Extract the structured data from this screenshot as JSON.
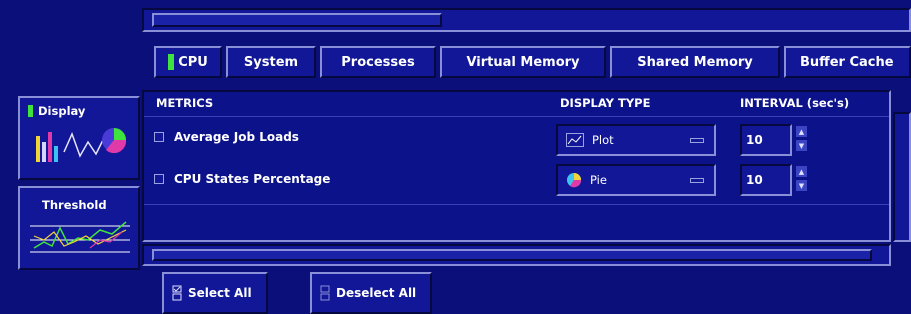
{
  "tabs": [
    {
      "label": "CPU",
      "selected": true
    },
    {
      "label": "System"
    },
    {
      "label": "Processes"
    },
    {
      "label": "Virtual Memory"
    },
    {
      "label": "Shared Memory"
    },
    {
      "label": "Buffer Cache"
    }
  ],
  "sidebar": {
    "display_label": "Display",
    "threshold_label": "Threshold"
  },
  "table": {
    "headers": {
      "metrics": "METRICS",
      "display_type": "DISPLAY TYPE",
      "interval": "INTERVAL (sec's)"
    },
    "rows": [
      {
        "metric": "Average Job Loads",
        "display_type": "Plot",
        "display_icon": "plot-icon",
        "interval": "10"
      },
      {
        "metric": "CPU States Percentage",
        "display_type": "Pie",
        "display_icon": "pie-icon",
        "interval": "10"
      }
    ]
  },
  "buttons": {
    "select_all": "Select All",
    "deselect_all": "Deselect All"
  },
  "colors": {
    "background": "#0a0f7a",
    "selected_marker": "#3fe33f"
  }
}
